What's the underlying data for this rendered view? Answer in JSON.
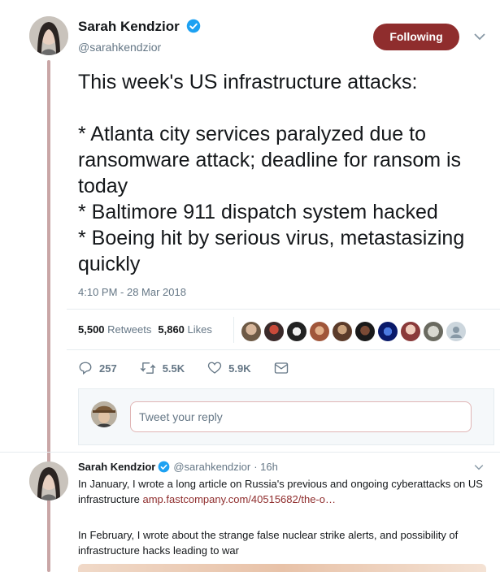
{
  "tweet": {
    "author_name": "Sarah Kendzior",
    "author_handle": "@sarahkendzior",
    "follow_label": "Following",
    "text": "This week's US infrastructure attacks:\n\n* Atlanta city services paralyzed due to ransomware attack; deadline for ransom is today\n* Baltimore 911 dispatch system hacked\n* Boeing hit by serious virus, metastasizing quickly",
    "timestamp": "4:10 PM - 28 Mar 2018",
    "retweets_count": "5,500",
    "retweets_label": "Retweets",
    "likes_count": "5,860",
    "likes_label": "Likes",
    "reply_count": "257",
    "retweet_action_count": "5.5K",
    "like_action_count": "5.9K"
  },
  "reply": {
    "placeholder": "Tweet your reply"
  },
  "reply_tweet": {
    "author_name": "Sarah Kendzior",
    "author_handle": "@sarahkendzior",
    "time": "· 16h",
    "para1_text": "In January, I wrote a long article on Russia's previous and ongoing cyberattacks on US infrastructure ",
    "para1_link": "amp.fastcompany.com/40515682/the-o…",
    "para2_text": "In February, I wrote about the strange false nuclear strike alerts, and possibility of infrastructure hacks leading to war"
  },
  "colors": {
    "accent": "#8f2d2d",
    "verified": "#1da1f2",
    "muted": "#657786"
  }
}
